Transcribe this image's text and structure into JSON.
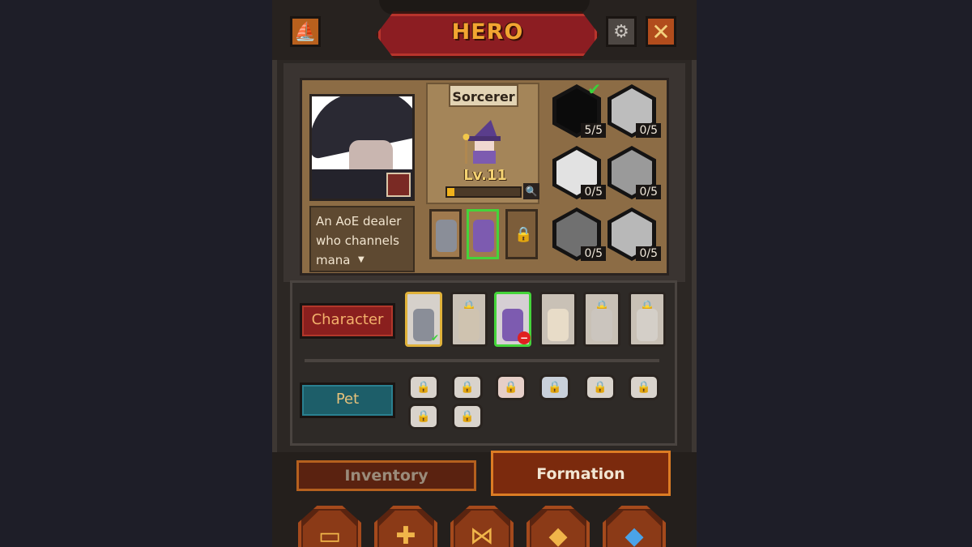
{
  "header": {
    "title": "HERO"
  },
  "icons": {
    "ship": "ship-icon",
    "gear": "gear-icon",
    "close": "close-icon"
  },
  "hero": {
    "class_name": "Sorcerer",
    "level": "Lv.11",
    "xp_fraction": 0.1,
    "description": "An AoE dealer who channels mana",
    "skills": [
      {
        "count": "5/5",
        "equipped": true
      },
      {
        "count": "0/5"
      },
      {
        "count": "0/5"
      },
      {
        "count": "0/5"
      },
      {
        "count": "0/5"
      },
      {
        "count": "0/5"
      }
    ]
  },
  "roster": {
    "character_tab": "Character",
    "pet_tab": "Pet"
  },
  "bottom_tabs": {
    "inventory": "Inventory",
    "formation": "Formation"
  },
  "colors": {
    "accent": "#f2a531",
    "selected": "#44d43a",
    "title_plate": "#8c1d22"
  }
}
